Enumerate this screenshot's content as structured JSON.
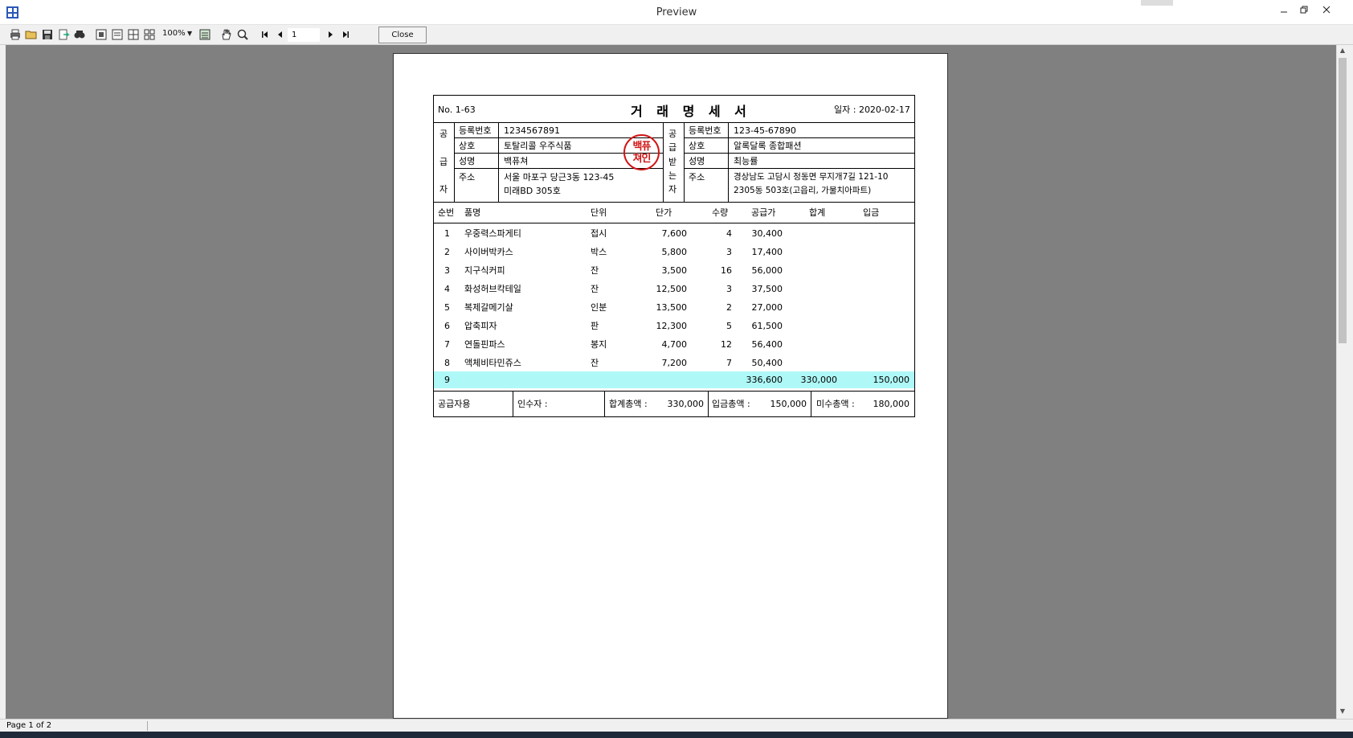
{
  "window": {
    "title": "Preview"
  },
  "toolbar": {
    "zoom": "100%",
    "page_input": "1",
    "close_label": "Close",
    "icons": [
      "print-icon",
      "open-icon",
      "save-icon",
      "export-icon",
      "find-icon",
      "single-page-icon",
      "two-pages-icon",
      "four-pages-icon",
      "multi-pages-icon",
      "page-width-icon",
      "hand-icon",
      "zoom-icon",
      "first-page-icon",
      "prev-page-icon",
      "next-page-icon",
      "last-page-icon"
    ]
  },
  "status": {
    "page": "Page 1 of 2"
  },
  "invoice": {
    "no": "No. 1-63",
    "title": "거 래 명 세 서",
    "date": "일자 : 2020-02-17",
    "supplier": {
      "side_label": [
        "공",
        "급",
        "자"
      ],
      "reg_label": "등록번호",
      "reg_value": "1234567891",
      "name_label": "상호",
      "name_value": "토탈리콜 우주식품",
      "owner_label": "성명",
      "owner_value": "백퓨쳐",
      "addr_label": "주소",
      "addr_line1": "서울 마포구 당근3동 123-45",
      "addr_line2": "미래BD 305호",
      "stamp_line1": "백퓨",
      "stamp_line2": "쳐인"
    },
    "receiver": {
      "side_label": [
        "공",
        "급",
        "받",
        "는",
        "자"
      ],
      "reg_label": "등록번호",
      "reg_value": "123-45-67890",
      "name_label": "상호",
      "name_value": "알록달록 종합패션",
      "owner_label": "성명",
      "owner_value": "최능률",
      "addr_label": "주소",
      "addr_line1": "경상남도 고담시 정동면 무지개7길 121-10",
      "addr_line2": "2305동 503호(고읍리, 가물치아파트)"
    },
    "columns": [
      "순번",
      "품명",
      "단위",
      "단가",
      "수량",
      "공급가",
      "합계",
      "입금"
    ],
    "rows": [
      {
        "no": "1",
        "item": "우중력스파게티",
        "unit": "접시",
        "price": "7,600",
        "qty": "4",
        "supply": "30,400"
      },
      {
        "no": "2",
        "item": "사이버박카스",
        "unit": "박스",
        "price": "5,800",
        "qty": "3",
        "supply": "17,400"
      },
      {
        "no": "3",
        "item": "지구식커피",
        "unit": "잔",
        "price": "3,500",
        "qty": "16",
        "supply": "56,000"
      },
      {
        "no": "4",
        "item": "화성허브칵테일",
        "unit": "잔",
        "price": "12,500",
        "qty": "3",
        "supply": "37,500"
      },
      {
        "no": "5",
        "item": "복제갈메기살",
        "unit": "인분",
        "price": "13,500",
        "qty": "2",
        "supply": "27,000"
      },
      {
        "no": "6",
        "item": "압축피자",
        "unit": "판",
        "price": "12,300",
        "qty": "5",
        "supply": "61,500"
      },
      {
        "no": "7",
        "item": "연돌핀파스",
        "unit": "봉지",
        "price": "4,700",
        "qty": "12",
        "supply": "56,400"
      },
      {
        "no": "8",
        "item": "액체비타민쥬스",
        "unit": "잔",
        "price": "7,200",
        "qty": "7",
        "supply": "50,400"
      }
    ],
    "total_row": {
      "no": "9",
      "supply": "336,600",
      "sum": "330,000",
      "paid": "150,000"
    },
    "footer": {
      "use": "공급자용",
      "receiver": "인수자 :",
      "total_label": "합계총액 :",
      "total_value": "330,000",
      "paid_label": "입금총액 :",
      "paid_value": "150,000",
      "unpaid_label": "미수총액 :",
      "unpaid_value": "180,000"
    }
  }
}
